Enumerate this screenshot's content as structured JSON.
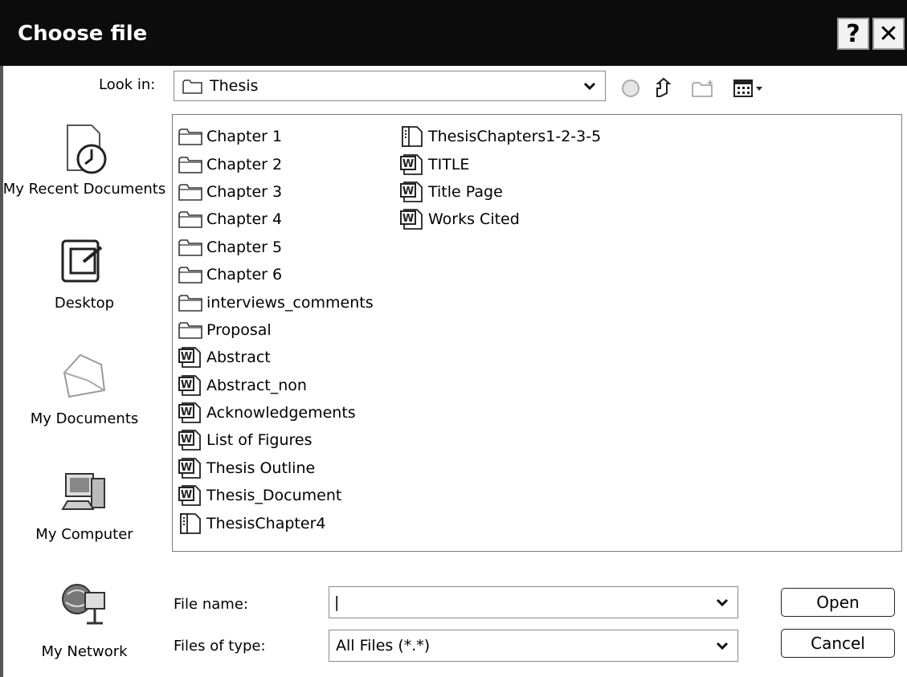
{
  "window": {
    "title": "Choose file"
  },
  "titlebar_buttons": {
    "help": "?",
    "close": "✕"
  },
  "look_in": {
    "label": "Look in:",
    "value": "Thesis"
  },
  "places": [
    {
      "label": "My Recent Documents",
      "icon": "recent-documents-icon"
    },
    {
      "label": "Desktop",
      "icon": "desktop-icon"
    },
    {
      "label": "My Documents",
      "icon": "my-documents-icon"
    },
    {
      "label": "My Computer",
      "icon": "my-computer-icon"
    },
    {
      "label": "My Network",
      "icon": "my-network-icon"
    }
  ],
  "files_col1": [
    {
      "name": "Chapter 1",
      "type": "folder"
    },
    {
      "name": "Chapter 2",
      "type": "folder"
    },
    {
      "name": "Chapter 3",
      "type": "folder"
    },
    {
      "name": "Chapter 4",
      "type": "folder"
    },
    {
      "name": "Chapter 5",
      "type": "folder"
    },
    {
      "name": "Chapter 6",
      "type": "folder"
    },
    {
      "name": "interviews_comments",
      "type": "folder"
    },
    {
      "name": "Proposal",
      "type": "folder"
    },
    {
      "name": "Abstract",
      "type": "word"
    },
    {
      "name": "Abstract_non",
      "type": "word"
    },
    {
      "name": "Acknowledgements",
      "type": "word"
    },
    {
      "name": "List of Figures",
      "type": "word"
    },
    {
      "name": "Thesis Outline",
      "type": "word"
    },
    {
      "name": "Thesis_Document",
      "type": "word"
    },
    {
      "name": "ThesisChapter4",
      "type": "archive"
    }
  ],
  "files_col2": [
    {
      "name": "ThesisChapters1-2-3-5",
      "type": "archive"
    },
    {
      "name": "TITLE",
      "type": "word"
    },
    {
      "name": "Title Page",
      "type": "word"
    },
    {
      "name": "Works Cited",
      "type": "word"
    }
  ],
  "file_name": {
    "label": "File name:",
    "value": "|"
  },
  "files_of_type": {
    "label": "Files of type:",
    "value": "All Files (*.*)"
  },
  "buttons": {
    "open": "Open",
    "cancel": "Cancel"
  }
}
